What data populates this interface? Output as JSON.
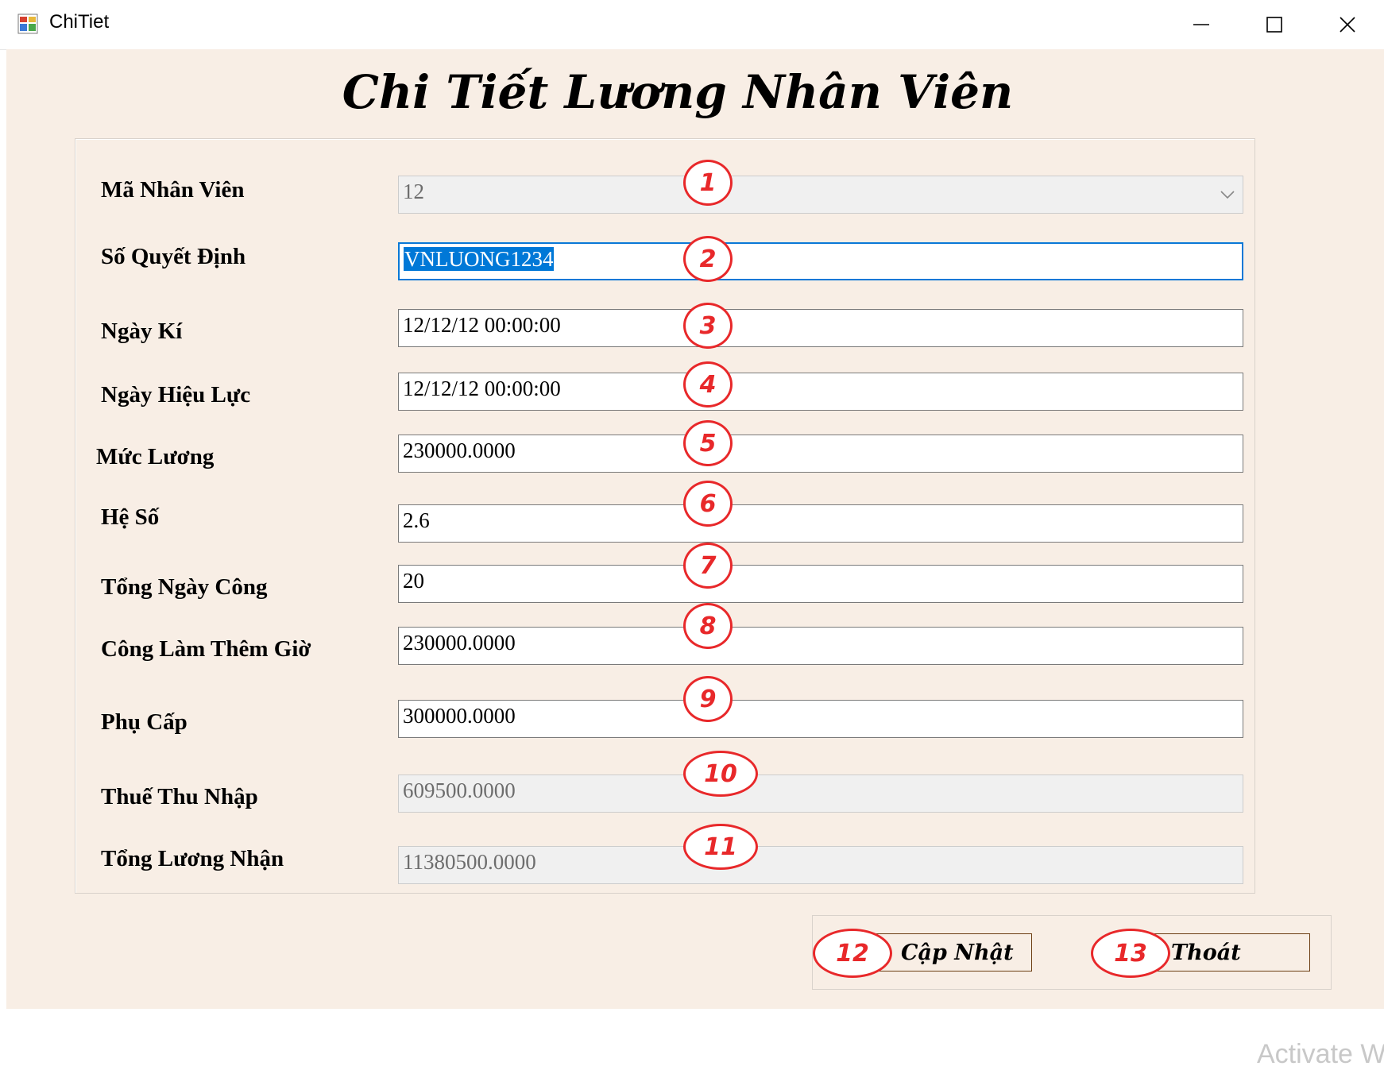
{
  "window": {
    "title": "ChiTiet",
    "minimize_icon": "minimize-icon",
    "maximize_icon": "maximize-icon",
    "close_icon": "close-icon"
  },
  "form": {
    "heading": "Chi Tiết Lương Nhân Viên",
    "fields": {
      "ma_nhan_vien": {
        "label": "Mã Nhân Viên",
        "value": "12",
        "marker": "1"
      },
      "so_quyet_dinh": {
        "label": "Số Quyết Định",
        "value": "VNLUONG1234",
        "marker": "2"
      },
      "ngay_ki": {
        "label": "Ngày Kí",
        "value": "12/12/12 00:00:00",
        "marker": "3"
      },
      "ngay_hieu_luc": {
        "label": "Ngày Hiệu Lực",
        "value": "12/12/12 00:00:00",
        "marker": "4"
      },
      "muc_luong": {
        "label": "Mức Lương",
        "value": "230000.0000",
        "marker": "5"
      },
      "he_so": {
        "label": "Hệ Số",
        "value": "2.6",
        "marker": "6"
      },
      "tong_ngay_cong": {
        "label": "Tổng Ngày Công",
        "value": "20",
        "marker": "7"
      },
      "cong_lam_them_gio": {
        "label": "Công Làm Thêm Giờ",
        "value": "230000.0000",
        "marker": "8"
      },
      "phu_cap": {
        "label": "Phụ Cấp",
        "value": "300000.0000",
        "marker": "9"
      },
      "thue_thu_nhap": {
        "label": "Thuế Thu Nhập",
        "value": "609500.0000",
        "marker": "10"
      },
      "tong_luong_nhan": {
        "label": "Tổng Lương Nhận",
        "value": "11380500.0000",
        "marker": "11"
      }
    },
    "buttons": {
      "update": {
        "label": "Cập Nhật",
        "marker": "12"
      },
      "exit": {
        "label": "Thoát",
        "marker": "13"
      }
    }
  },
  "watermark": "Activate W",
  "colors": {
    "form_background": "#f8eee5",
    "marker_red": "#e8282a",
    "selection_blue": "#0078d7",
    "button_border": "#6b3d12"
  }
}
